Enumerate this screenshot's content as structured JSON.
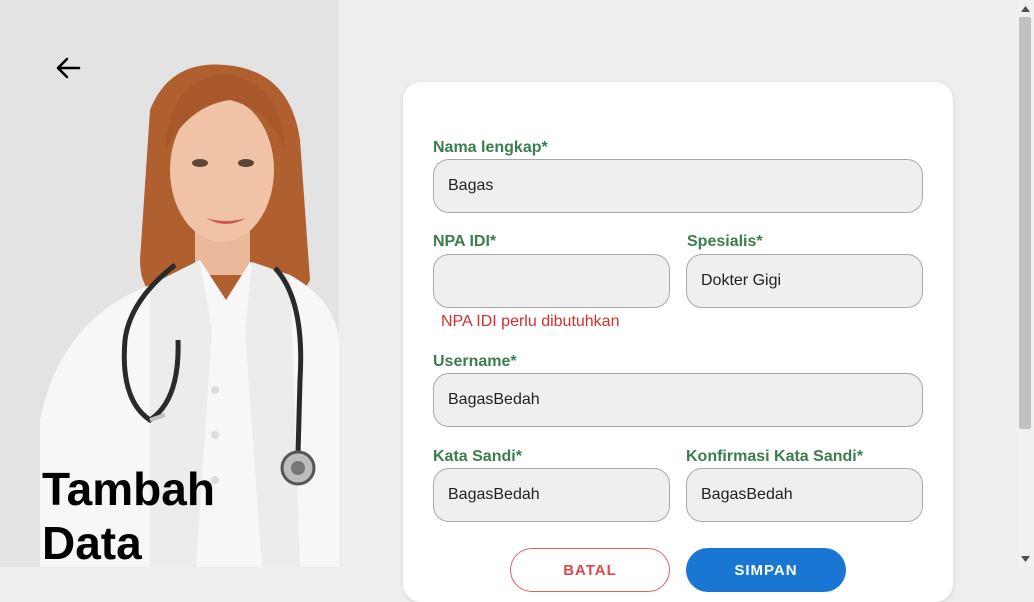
{
  "page": {
    "title": "Tambah Data",
    "back_icon": "arrow-left-icon"
  },
  "form": {
    "full_name": {
      "label": "Nama lengkap*",
      "value": "Bagas"
    },
    "npa_idi": {
      "label": "NPA IDI*",
      "value": "",
      "error": "NPA IDI perlu dibutuhkan"
    },
    "specialist": {
      "label": "Spesialis*",
      "value": "Dokter Gigi"
    },
    "username": {
      "label": "Username*",
      "value": "BagasBedah"
    },
    "password": {
      "label": "Kata Sandi*",
      "value": "BagasBedah"
    },
    "confirm_password": {
      "label": "Konfirmasi Kata Sandi*",
      "value": "BagasBedah"
    },
    "cancel_label": "BATAL",
    "save_label": "SIMPAN"
  },
  "colors": {
    "label": "#3b7d4f",
    "error": "#d32f2f",
    "primary": "#1976d2",
    "cancel": "#e04848"
  }
}
